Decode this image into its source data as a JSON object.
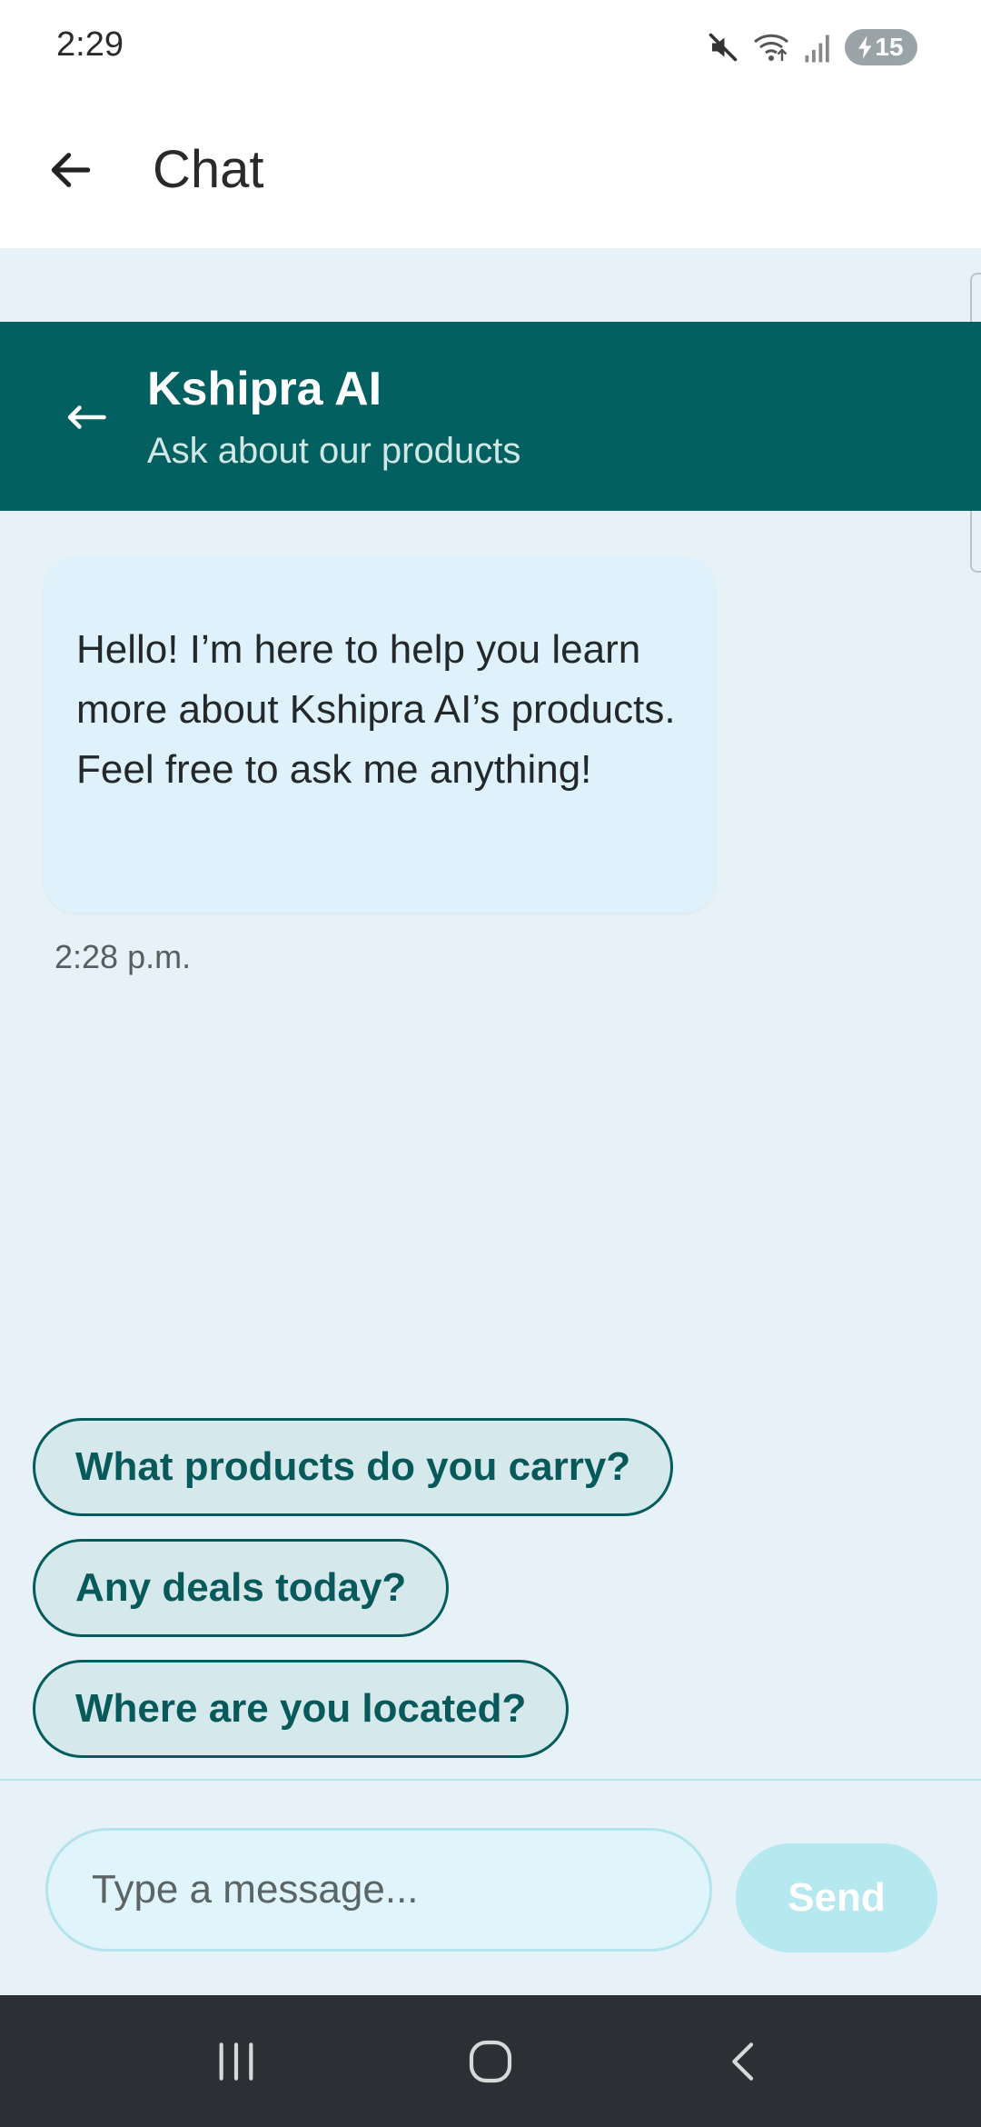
{
  "status_bar": {
    "time": "2:29",
    "battery": "15",
    "icons": [
      "mute-icon",
      "wifi-icon",
      "signal-icon",
      "battery-charging-icon"
    ]
  },
  "app_bar": {
    "title": "Chat",
    "back_icon": "arrow-left-icon"
  },
  "chat_header": {
    "title": "Kshipra AI",
    "subtitle": "Ask about our products",
    "back_icon": "arrow-left-icon",
    "color": "#036061"
  },
  "messages": [
    {
      "sender": "bot",
      "text": "Hello! I’m here to help you learn more about Kshipra AI’s products. Feel free to ask me anything!",
      "time": "2:28 p.m."
    }
  ],
  "suggestions": [
    "What products do you carry?",
    "Any deals today?",
    "Where are you located?"
  ],
  "composer": {
    "placeholder": "Type a message...",
    "value": "",
    "send_label": "Send"
  },
  "nav_bar": {
    "buttons": [
      "recents-icon",
      "home-icon",
      "back-icon"
    ]
  }
}
